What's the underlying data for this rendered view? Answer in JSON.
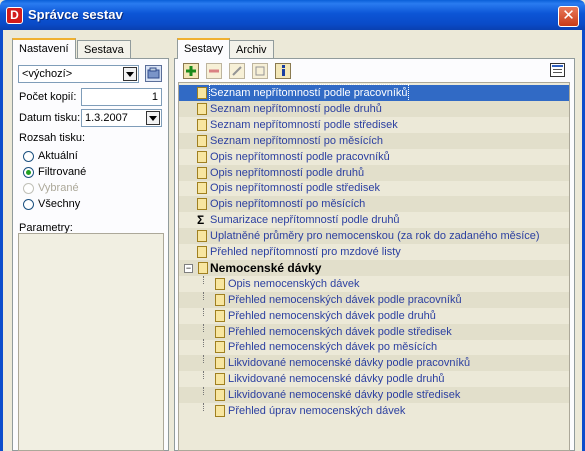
{
  "window": {
    "title": "Správce sestav",
    "close_glyph": "✕",
    "app_icon": "D"
  },
  "left_tabs": [
    {
      "label": "Nastavení"
    },
    {
      "label": "Sestava"
    }
  ],
  "left": {
    "preset_value": "<výchozí>",
    "copies_label": "Počet kopií:",
    "copies_value": "1",
    "date_label": "Datum tisku:",
    "date_value": "1.3.2007",
    "range_label": "Rozsah tisku:",
    "radios": [
      {
        "label": "Aktuální",
        "checked": false,
        "disabled": false
      },
      {
        "label": "Filtrované",
        "checked": true,
        "disabled": false
      },
      {
        "label": "Vybrané",
        "checked": false,
        "disabled": true
      },
      {
        "label": "Všechny",
        "checked": false,
        "disabled": false
      }
    ],
    "params_label": "Parametry:"
  },
  "right_tabs": [
    {
      "label": "Sestavy"
    },
    {
      "label": "Archiv"
    }
  ],
  "toolbar": [
    "add-report-icon",
    "delete-report-icon",
    "edit-report-icon",
    "copy-report-icon",
    "info-report-icon",
    "layout-icon"
  ],
  "reports": [
    {
      "text": "Seznam nepřítomností podle pracovníků",
      "icon": "doc",
      "selected": true
    },
    {
      "text": "Seznam nepřítomností podle druhů",
      "icon": "doc"
    },
    {
      "text": "Seznam nepřítomností podle středisek",
      "icon": "doc"
    },
    {
      "text": "Seznam nepřítomností po měsících",
      "icon": "doc"
    },
    {
      "text": "Opis nepřítomností podle pracovníků",
      "icon": "doc"
    },
    {
      "text": "Opis nepřítomností podle druhů",
      "icon": "doc"
    },
    {
      "text": "Opis nepřítomností podle středisek",
      "icon": "doc"
    },
    {
      "text": "Opis nepřítomností po měsících",
      "icon": "doc"
    },
    {
      "text": "Sumarizace nepřítomností podle druhů",
      "icon": "sigma"
    },
    {
      "text": "Uplatněné průměry pro nemocenskou (za rok do zadaného měsíce)",
      "icon": "doc"
    },
    {
      "text": "Přehled nepřítomností pro mzdové listy",
      "icon": "doc"
    },
    {
      "text": "Nemocenské dávky",
      "icon": "folder",
      "group": true
    },
    {
      "text": "Opis nemocenských dávek",
      "icon": "doc",
      "child": true
    },
    {
      "text": "Přehled nemocenských dávek podle pracovníků",
      "icon": "doc",
      "child": true
    },
    {
      "text": "Přehled nemocenských dávek podle druhů",
      "icon": "doc",
      "child": true
    },
    {
      "text": "Přehled nemocenských dávek podle středisek",
      "icon": "doc",
      "child": true
    },
    {
      "text": "Přehled nemocenských dávek po měsících",
      "icon": "doc",
      "child": true
    },
    {
      "text": "Likvidované nemocenské dávky podle pracovníků",
      "icon": "doc",
      "child": true
    },
    {
      "text": "Likvidované nemocenské dávky podle druhů",
      "icon": "doc",
      "child": true
    },
    {
      "text": "Likvidované nemocenské dávky podle středisek",
      "icon": "doc",
      "child": true
    },
    {
      "text": "Přehled úprav nemocenských dávek",
      "icon": "doc",
      "child": true
    }
  ]
}
